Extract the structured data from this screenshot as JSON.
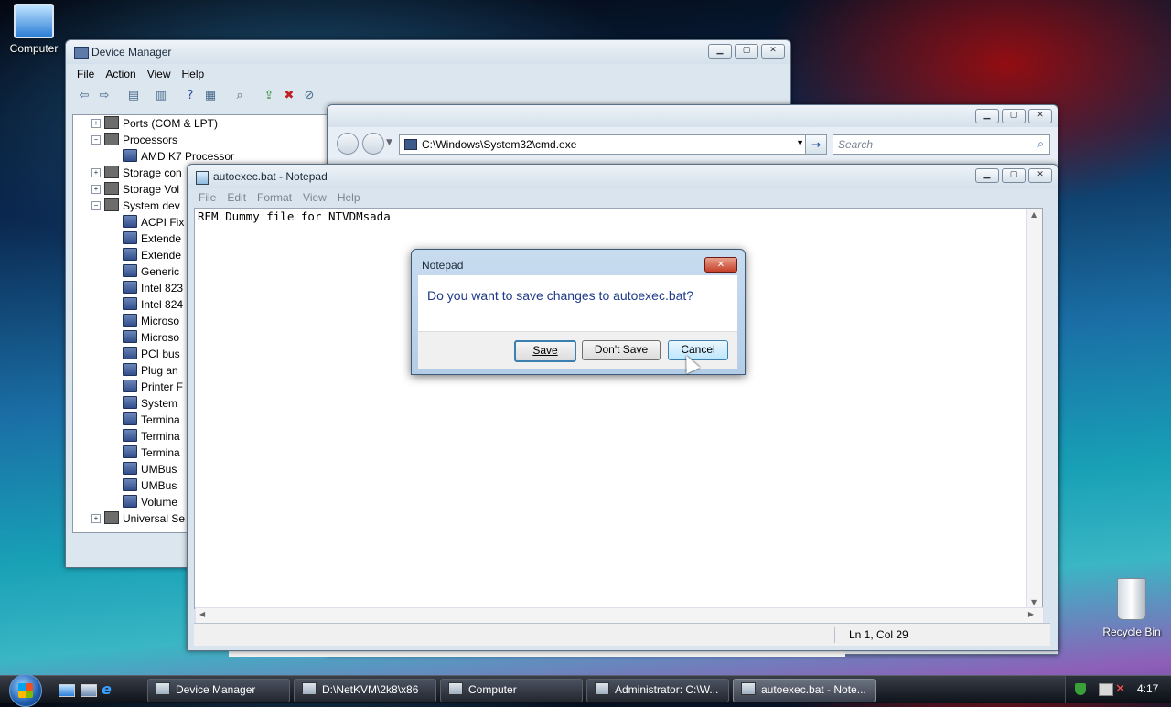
{
  "desktop": {
    "computer_icon_label": "Computer",
    "recycle_bin_label": "Recycle Bin"
  },
  "device_manager": {
    "title": "Device Manager",
    "menu": [
      "File",
      "Action",
      "View",
      "Help"
    ],
    "tree": [
      {
        "label": "Ports (COM & LPT)",
        "level": 1,
        "expander": "+"
      },
      {
        "label": "Processors",
        "level": 1,
        "expander": "−"
      },
      {
        "label": "AMD K7 Processor",
        "level": 2,
        "expander": ""
      },
      {
        "label": "Storage con",
        "level": 1,
        "expander": "+"
      },
      {
        "label": "Storage Vol",
        "level": 1,
        "expander": "+"
      },
      {
        "label": "System dev",
        "level": 1,
        "expander": "−"
      },
      {
        "label": "ACPI Fix",
        "level": 2,
        "expander": ""
      },
      {
        "label": "Extende",
        "level": 2,
        "expander": ""
      },
      {
        "label": "Extende",
        "level": 2,
        "expander": ""
      },
      {
        "label": "Generic",
        "level": 2,
        "expander": ""
      },
      {
        "label": "Intel 823",
        "level": 2,
        "expander": ""
      },
      {
        "label": "Intel 824",
        "level": 2,
        "expander": ""
      },
      {
        "label": "Microso",
        "level": 2,
        "expander": ""
      },
      {
        "label": "Microso",
        "level": 2,
        "expander": ""
      },
      {
        "label": "PCI bus",
        "level": 2,
        "expander": ""
      },
      {
        "label": "Plug an",
        "level": 2,
        "expander": ""
      },
      {
        "label": "Printer F",
        "level": 2,
        "expander": ""
      },
      {
        "label": "System",
        "level": 2,
        "expander": ""
      },
      {
        "label": "Termina",
        "level": 2,
        "expander": ""
      },
      {
        "label": "Termina",
        "level": 2,
        "expander": ""
      },
      {
        "label": "Termina",
        "level": 2,
        "expander": ""
      },
      {
        "label": "UMBus",
        "level": 2,
        "expander": ""
      },
      {
        "label": "UMBus",
        "level": 2,
        "expander": ""
      },
      {
        "label": "Volume",
        "level": 2,
        "expander": ""
      },
      {
        "label": "Universal Se",
        "level": 1,
        "expander": "+"
      }
    ]
  },
  "explorer": {
    "address": "C:\\Windows\\System32\\cmd.exe",
    "search_placeholder": "Search"
  },
  "notepad": {
    "title": "autoexec.bat - Notepad",
    "menu": [
      "File",
      "Edit",
      "Format",
      "View",
      "Help"
    ],
    "content": "REM Dummy file for NTVDMsada",
    "status": "Ln 1, Col 29"
  },
  "dialog": {
    "title": "Notepad",
    "message": "Do you want to save changes to autoexec.bat?",
    "save_label": "Save",
    "dont_save_label": "Don't Save",
    "cancel_label": "Cancel"
  },
  "taskbar": {
    "buttons": [
      {
        "label": "Device Manager",
        "active": false
      },
      {
        "label": "D:\\NetKVM\\2k8\\x86",
        "active": false
      },
      {
        "label": "Computer",
        "active": false
      },
      {
        "label": "Administrator: C:\\W...",
        "active": false
      },
      {
        "label": "autoexec.bat - Note...",
        "active": true
      }
    ],
    "clock": "4:17"
  }
}
